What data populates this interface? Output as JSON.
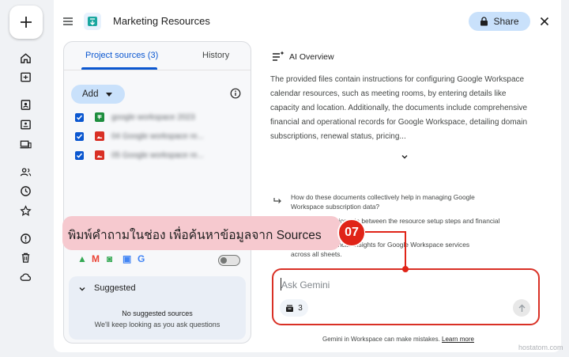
{
  "header": {
    "title": "Marketing Resources",
    "share_label": "Share"
  },
  "sources": {
    "tabs": [
      {
        "label": "Project sources (3)",
        "active": true
      },
      {
        "label": "History",
        "active": false
      }
    ],
    "add_label": "Add",
    "items": [
      {
        "name": "google workspace 2023",
        "type": "sheets",
        "checked": true
      },
      {
        "name": "04 Google workspace re...",
        "type": "image",
        "checked": true
      },
      {
        "name": "05 Google workspace re...",
        "type": "image",
        "checked": true
      }
    ],
    "workspace_toggle_on": false,
    "suggested": {
      "title": "Suggested",
      "empty_title": "No suggested sources",
      "empty_subtitle": "We'll keep looking as you ask questions"
    }
  },
  "overview": {
    "title": "AI Overview",
    "text": "The provided files contain instructions for configuring Google Workspace calendar resources, such as meeting rooms, by entering details like capacity and location. Additionally, the documents include comprehensive financial and operational records for Google Workspace, detailing domain subscriptions, renewal status, pricing..."
  },
  "questions": [
    {
      "line1": "How do these documents collectively help in managing Google",
      "line2": "Workspace subscription data?"
    },
    {
      "line1": "What is the relationship between the resource setup steps and financial",
      "line2": ""
    },
    {
      "line1": "Provide key financial insights for Google Workspace services",
      "line2": "across all sheets."
    }
  ],
  "ask": {
    "placeholder": "Ask Gemini",
    "source_count": "3"
  },
  "footer": {
    "text": "Gemini in Workspace can make mistakes.",
    "link": "Learn more"
  },
  "callout": {
    "text": "พิมพ์คำถามในช่อง เพื่อค้นหาข้อมูลจาก Sources",
    "step": "07"
  },
  "watermark": "hostatom.com",
  "colors": {
    "accent": "#0b57d0",
    "button_bg": "#c9e1fb",
    "callout_bg": "#f6c9cf",
    "callout_red": "#e02418"
  }
}
